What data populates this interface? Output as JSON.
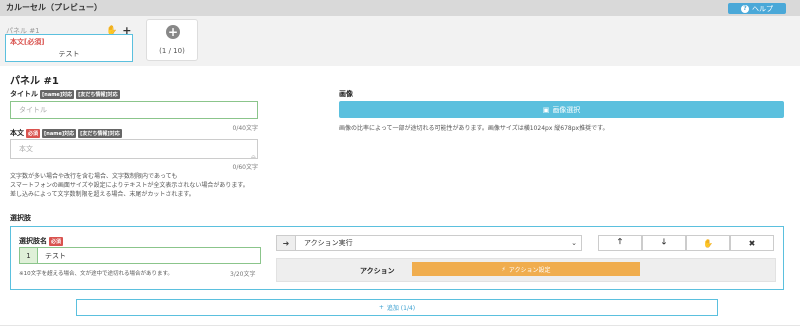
{
  "header": {
    "title": "カルーセル（プレビュー）",
    "help_label": "ヘルプ"
  },
  "preview": {
    "panel_label": "パネル #1",
    "card_heading": "本文[必須]",
    "card_text": "テスト",
    "panel_count": "(1 / 10)"
  },
  "form": {
    "section_title": "パネル #1",
    "title_label": "タイトル",
    "tag_name": "[name]対応",
    "tag_friend": "[友だち情報]対応",
    "title_placeholder": "タイトル",
    "title_counter": "0/40文字",
    "body_label": "本文",
    "tag_required": "必須",
    "body_placeholder": "本文",
    "body_counter": "0/60文字",
    "note_lines": [
      "文字数が多い場合や改行を含む場合、文字数制限内であっても",
      "スマートフォンの画面サイズや設定によりテキストが全文表示されない場合があります。",
      "差し込みによって文字数制限を超える場合、末尾がカットされます。"
    ]
  },
  "image": {
    "label": "画像",
    "button_label": "画像選択",
    "note": "画像の比率によって一部が途切れる可能性があります。画像サイズは横1024px 縦678px推奨です。"
  },
  "choices": {
    "section_label": "選択肢",
    "name_label": "選択肢名",
    "required_tag": "必須",
    "item_number": "1",
    "item_value": "テスト",
    "item_note": "※10文字を超える場合、文が途中で途切れる場合があります。",
    "item_counter": "3/20文字",
    "action_select": "アクション実行",
    "action_title": "アクション",
    "action_button": "アクション設定",
    "add_button": "追加 (1/4)"
  },
  "colors": {
    "accent": "#5bc0de",
    "warning": "#f0ad4e",
    "danger": "#d9534f",
    "success_border": "#8bc58b"
  }
}
